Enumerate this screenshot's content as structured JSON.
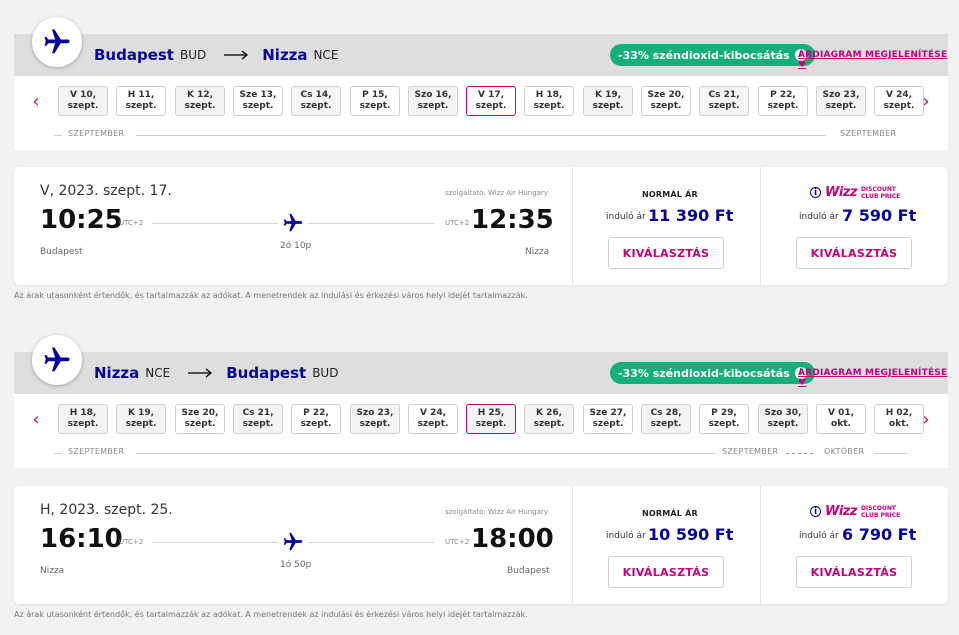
{
  "brand": {
    "accent": "#c6007e",
    "navy": "#06049f",
    "green": "#15b07a"
  },
  "outbound": {
    "icon": "plane-icon",
    "origin_city": "Budapest",
    "origin_code": "BUD",
    "destination_city": "Nizza",
    "destination_code": "NCE",
    "co2_badge": "-33% széndioxid-kibocsátás",
    "price_chart_link": "ÁRDIAGRAM MEGJELENÍTÉSE",
    "dates": [
      {
        "day": "V 10,",
        "month": "szept.",
        "shaded": true
      },
      {
        "day": "H 11,",
        "month": "szept.",
        "shaded": false
      },
      {
        "day": "K 12,",
        "month": "szept.",
        "shaded": true
      },
      {
        "day": "Sze 13,",
        "month": "szept.",
        "shaded": false
      },
      {
        "day": "Cs 14,",
        "month": "szept.",
        "shaded": true
      },
      {
        "day": "P 15,",
        "month": "szept.",
        "shaded": false
      },
      {
        "day": "Szo 16,",
        "month": "szept.",
        "shaded": true
      },
      {
        "day": "V 17,",
        "month": "szept.",
        "shaded": false,
        "active": true
      },
      {
        "day": "H 18,",
        "month": "szept.",
        "shaded": false
      },
      {
        "day": "K 19,",
        "month": "szept.",
        "shaded": true
      },
      {
        "day": "Sze 20,",
        "month": "szept.",
        "shaded": false
      },
      {
        "day": "Cs 21,",
        "month": "szept.",
        "shaded": true
      },
      {
        "day": "P 22,",
        "month": "szept.",
        "shaded": false
      },
      {
        "day": "Szo 23,",
        "month": "szept.",
        "shaded": true
      },
      {
        "day": "V 24,",
        "month": "szept.",
        "shaded": false
      }
    ],
    "month_left": "SZEPTEMBER",
    "month_right": "SZEPTEMBER",
    "flight": {
      "date": "V, 2023. szept. 17.",
      "operator": "szolgáltató: Wizz Air Hungary",
      "dep_time": "10:25",
      "dep_utc": "UTC+2",
      "arr_time": "12:35",
      "arr_utc": "UTC+2",
      "duration": "2ó 10p",
      "dep_place": "Budapest",
      "arr_place": "Nizza",
      "normal_title": "NORMÁL ÁR",
      "from_label": "induló ár",
      "normal_price": "11 390 Ft",
      "discount_from_label": "induló ár",
      "discount_price": "7 590 Ft",
      "select_label": "KIVÁLASZTÁS",
      "wizz_word": "Wizz",
      "dc_line1": "DISCOUNT",
      "dc_line2": "CLUB PRICE"
    },
    "disclaimer": "Az árak utasonként értendők, és tartalmazzák az adókat. A menetrendek az indulási és érkezési város helyi idejét tartalmazzák."
  },
  "return": {
    "icon": "plane-icon",
    "origin_city": "Nizza",
    "origin_code": "NCE",
    "destination_city": "Budapest",
    "destination_code": "BUD",
    "co2_badge": "-33% széndioxid-kibocsátás",
    "price_chart_link": "ÁRDIAGRAM MEGJELENÍTÉSE",
    "dates": [
      {
        "day": "H 18,",
        "month": "szept.",
        "shaded": true
      },
      {
        "day": "K 19,",
        "month": "szept.",
        "shaded": true
      },
      {
        "day": "Sze 20,",
        "month": "szept.",
        "shaded": false
      },
      {
        "day": "Cs 21,",
        "month": "szept.",
        "shaded": true
      },
      {
        "day": "P 22,",
        "month": "szept.",
        "shaded": false
      },
      {
        "day": "Szo 23,",
        "month": "szept.",
        "shaded": true
      },
      {
        "day": "V 24,",
        "month": "szept.",
        "shaded": false
      },
      {
        "day": "H 25,",
        "month": "szept.",
        "shaded": true,
        "active": true
      },
      {
        "day": "K 26,",
        "month": "szept.",
        "shaded": true
      },
      {
        "day": "Sze 27,",
        "month": "szept.",
        "shaded": false
      },
      {
        "day": "Cs 28,",
        "month": "szept.",
        "shaded": true
      },
      {
        "day": "P 29,",
        "month": "szept.",
        "shaded": false
      },
      {
        "day": "Szo 30,",
        "month": "szept.",
        "shaded": true
      },
      {
        "day": "V 01,",
        "month": "okt.",
        "shaded": false
      },
      {
        "day": "H 02,",
        "month": "okt.",
        "shaded": false
      }
    ],
    "month_left": "SZEPTEMBER",
    "month_mid": "SZEPTEMBER",
    "month_right": "OKTÓBER",
    "flight": {
      "date": "H, 2023. szept. 25.",
      "operator": "szolgáltató: Wizz Air Hungary",
      "dep_time": "16:10",
      "dep_utc": "UTC+2",
      "arr_time": "18:00",
      "arr_utc": "UTC+2",
      "duration": "1ó 50p",
      "dep_place": "Nizza",
      "arr_place": "Budapest",
      "normal_title": "NORMÁL ÁR",
      "from_label": "induló ár",
      "normal_price": "10 590 Ft",
      "discount_from_label": "induló ár",
      "discount_price": "6 790 Ft",
      "select_label": "KIVÁLASZTÁS",
      "wizz_word": "Wizz",
      "dc_line1": "DISCOUNT",
      "dc_line2": "CLUB PRICE"
    },
    "disclaimer": "Az árak utasonként értendők, és tartalmazzák az adókat. A menetrendek az indulási és érkezési város helyi idejét tartalmazzák."
  }
}
